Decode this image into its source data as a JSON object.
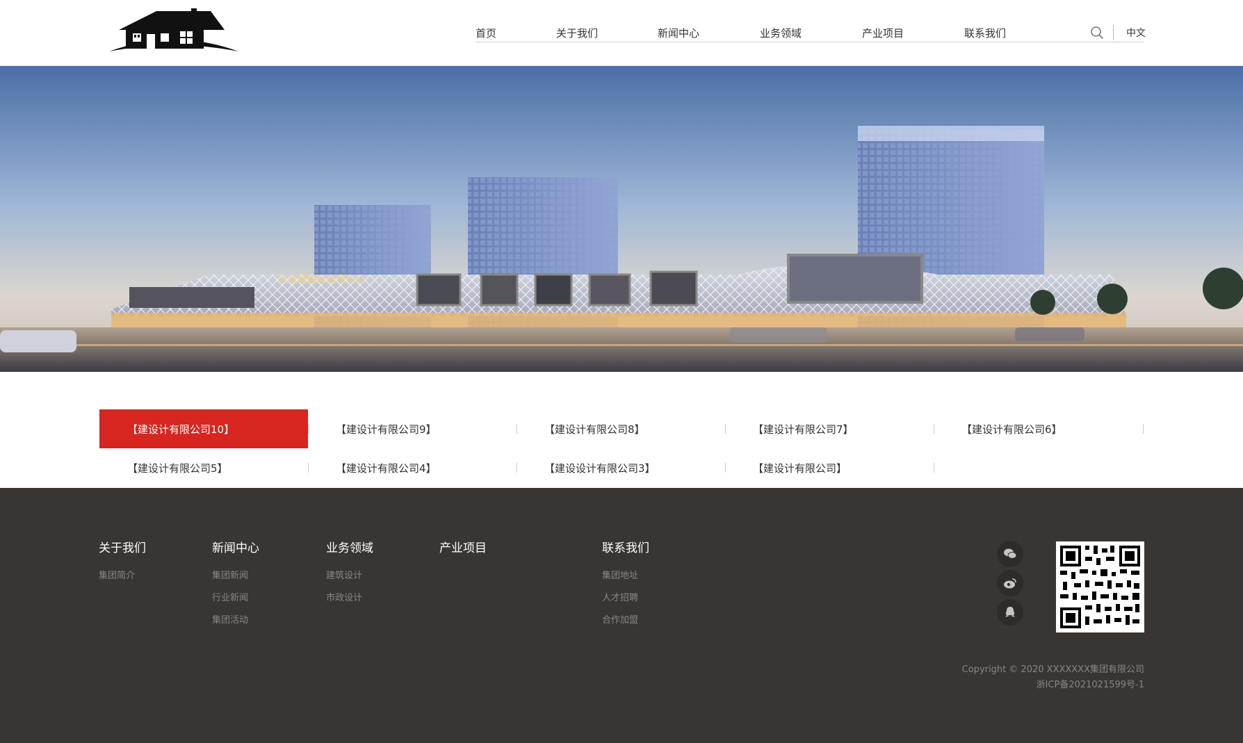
{
  "header": {
    "nav": [
      "首页",
      "关于我们",
      "新闻中心",
      "业务领域",
      "产业项目",
      "联系我们"
    ],
    "lang": "中文",
    "icons": {
      "search": "search-icon"
    }
  },
  "banner": {
    "sign_text": "大家城国际商贸中心"
  },
  "companies": {
    "items": [
      "【建设计有限公司10】",
      "【建设计有限公司9】",
      "【建设计有限公司8】",
      "【建设计有限公司7】",
      "【建设计有限公司6】",
      "【建设计有限公司5】",
      "【建设计有限公司4】",
      "【建设设计有限公司3】",
      "【建设计有限公司】"
    ],
    "active_index": 0,
    "active_color": "#d7251f"
  },
  "footer": {
    "columns": [
      {
        "title": "关于我们",
        "links": [
          "集团简介"
        ]
      },
      {
        "title": "新闻中心",
        "links": [
          "集团新闻",
          "行业新闻",
          "集团活动"
        ]
      },
      {
        "title": "业务领域",
        "links": [
          "建筑设计",
          "市政设计"
        ]
      },
      {
        "title": "产业项目",
        "links": []
      },
      {
        "title": "联系我们",
        "links": [
          "集团地址",
          "人才招聘",
          "合作加盟"
        ]
      }
    ],
    "social_icons": [
      "wechat-icon",
      "weibo-icon",
      "qq-icon"
    ],
    "copyright": "Copyright © 2020 XXXXXXX集团有限公司",
    "icp": "浙ICP备2021021599号-1",
    "background": "#393533"
  }
}
